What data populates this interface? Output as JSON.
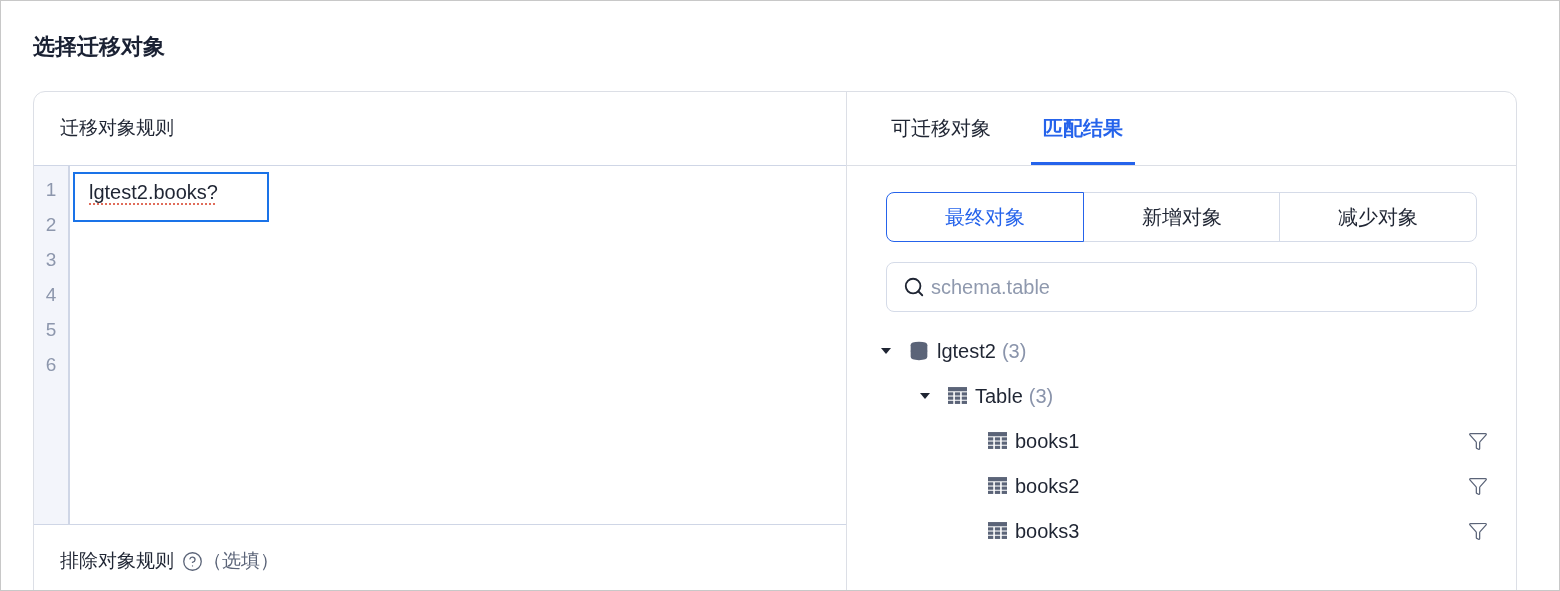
{
  "title": "选择迁移对象",
  "rules_panel": {
    "title": "迁移对象规则",
    "lines": [
      {
        "number": "1",
        "text": "lgtest2.books?",
        "spell_error": true,
        "focused": true
      },
      {
        "number": "2"
      },
      {
        "number": "3"
      },
      {
        "number": "4"
      },
      {
        "number": "5"
      },
      {
        "number": "6"
      }
    ],
    "exclude": {
      "label": "排除对象规则",
      "hint": "（选填）"
    }
  },
  "result_panel": {
    "tabs": [
      {
        "label": "可迁移对象",
        "selected": false
      },
      {
        "label": "匹配结果",
        "selected": true
      }
    ],
    "segments": [
      {
        "label": "最终对象",
        "selected": true
      },
      {
        "label": "新增对象",
        "selected": false
      },
      {
        "label": "减少对象",
        "selected": false
      }
    ],
    "search": {
      "placeholder": "schema.table"
    },
    "tree": [
      {
        "kind": "database",
        "name": "lgtest2",
        "count": "(3)",
        "expanded": true,
        "children": [
          {
            "kind": "group",
            "name": "Table",
            "count": "(3)",
            "expanded": true,
            "children": [
              {
                "kind": "table",
                "name": "books1"
              },
              {
                "kind": "table",
                "name": "books2"
              },
              {
                "kind": "table",
                "name": "books3"
              }
            ]
          }
        ]
      }
    ]
  }
}
